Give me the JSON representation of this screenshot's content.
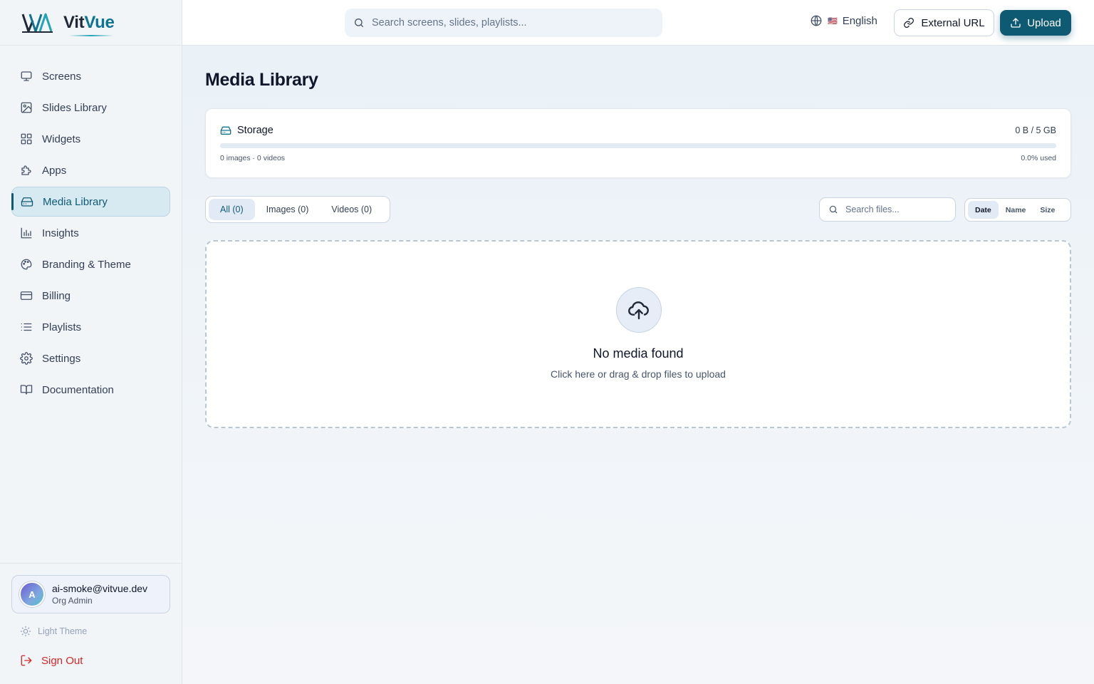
{
  "brand": {
    "name_prefix": "Vit",
    "name_accent": "Vue"
  },
  "sidebar": {
    "items": [
      {
        "label": "Screens",
        "icon": "monitor-icon"
      },
      {
        "label": "Slides Library",
        "icon": "image-icon"
      },
      {
        "label": "Widgets",
        "icon": "grid-icon"
      },
      {
        "label": "Apps",
        "icon": "puzzle-icon"
      },
      {
        "label": "Media Library",
        "icon": "hard-drive-icon",
        "active": true
      },
      {
        "label": "Insights",
        "icon": "bar-chart-icon"
      },
      {
        "label": "Branding & Theme",
        "icon": "palette-icon"
      },
      {
        "label": "Billing",
        "icon": "credit-card-icon"
      },
      {
        "label": "Playlists",
        "icon": "list-icon"
      },
      {
        "label": "Settings",
        "icon": "gear-icon"
      },
      {
        "label": "Documentation",
        "icon": "book-icon"
      }
    ],
    "user": {
      "initial": "A",
      "email": "ai-smoke@vitvue.dev",
      "role": "Org Admin"
    },
    "theme_label": "Light Theme",
    "signout_label": "Sign Out"
  },
  "topbar": {
    "search_placeholder": "Search screens, slides, playlists...",
    "language_flag": "🇺🇸",
    "language": "English",
    "external_url_label": "External URL",
    "upload_label": "Upload"
  },
  "main": {
    "title": "Media Library",
    "storage": {
      "label": "Storage",
      "usage": "0 B / 5 GB",
      "counts": "0 images · 0 videos",
      "percent_label": "0.0% used",
      "fraction_used": 0.0
    },
    "filters": [
      {
        "label": "All (0)",
        "active": true
      },
      {
        "label": "Images (0)",
        "active": false
      },
      {
        "label": "Videos (0)",
        "active": false
      }
    ],
    "file_search_placeholder": "Search files...",
    "sort_options": [
      {
        "label": "Date",
        "active": true
      },
      {
        "label": "Name",
        "active": false
      },
      {
        "label": "Size",
        "active": false
      }
    ],
    "empty": {
      "title": "No media found",
      "subtitle": "Click here or drag & drop files to upload"
    }
  },
  "colors": {
    "accent": "#0e5a72",
    "accent_light": "#0e7490",
    "danger": "#dc2626"
  }
}
